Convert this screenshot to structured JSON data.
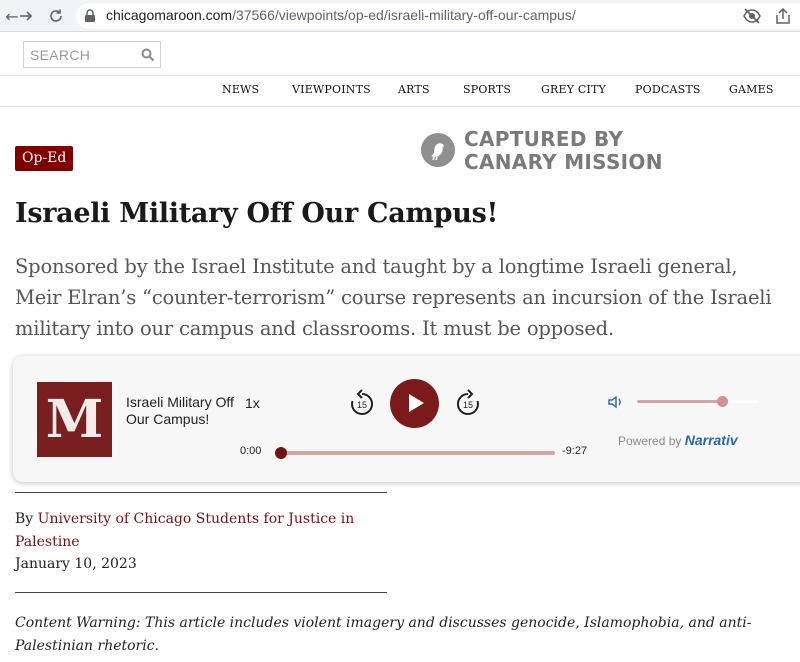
{
  "browser": {
    "url_host": "chicagomaroon.com",
    "url_path": "/37566/viewpoints/op-ed/israeli-military-off-our-campus/",
    "back_icon": "arrow-left-icon",
    "forward_icon": "arrow-right-icon",
    "reload_icon": "reload-icon"
  },
  "header": {
    "search_placeholder": "SEARCH",
    "nav": [
      "NEWS",
      "VIEWPOINTS",
      "ARTS",
      "SPORTS",
      "GREY CITY",
      "PODCASTS",
      "GAMES"
    ]
  },
  "article": {
    "tag": "Op-Ed",
    "captured_line1": "CAPTURED BY",
    "captured_line2": "CANARY MISSION",
    "title": "Israeli Military Off Our Campus!",
    "dek": "Sponsored by the Israel Institute and taught by a longtime Israeli general, Meir Elran’s “counter-terrorism” course represents an incursion of the Israeli military into our campus and classrooms. It must be opposed.",
    "byline_prefix": "By ",
    "author": "University of Chicago Students for Justice in Palestine",
    "date": "January 10, 2023",
    "content_warning": "Content Warning: This article includes violent imagery and discusses genocide, Islamophobia, and anti-Palestinian rhetoric."
  },
  "player": {
    "logo_letter": "M",
    "title": "Israeli Military Off Our Campus!",
    "speed": "1x",
    "skip_back": "15",
    "skip_forward": "15",
    "time_current": "0:00",
    "time_remaining": "-9:27",
    "progress": 0,
    "volume": 0.7,
    "powered_by": "Powered by",
    "brand": "Narrativ"
  },
  "colors": {
    "maroon": "#800000",
    "link": "#7a1010",
    "player_accent": "#d4a5a5"
  }
}
